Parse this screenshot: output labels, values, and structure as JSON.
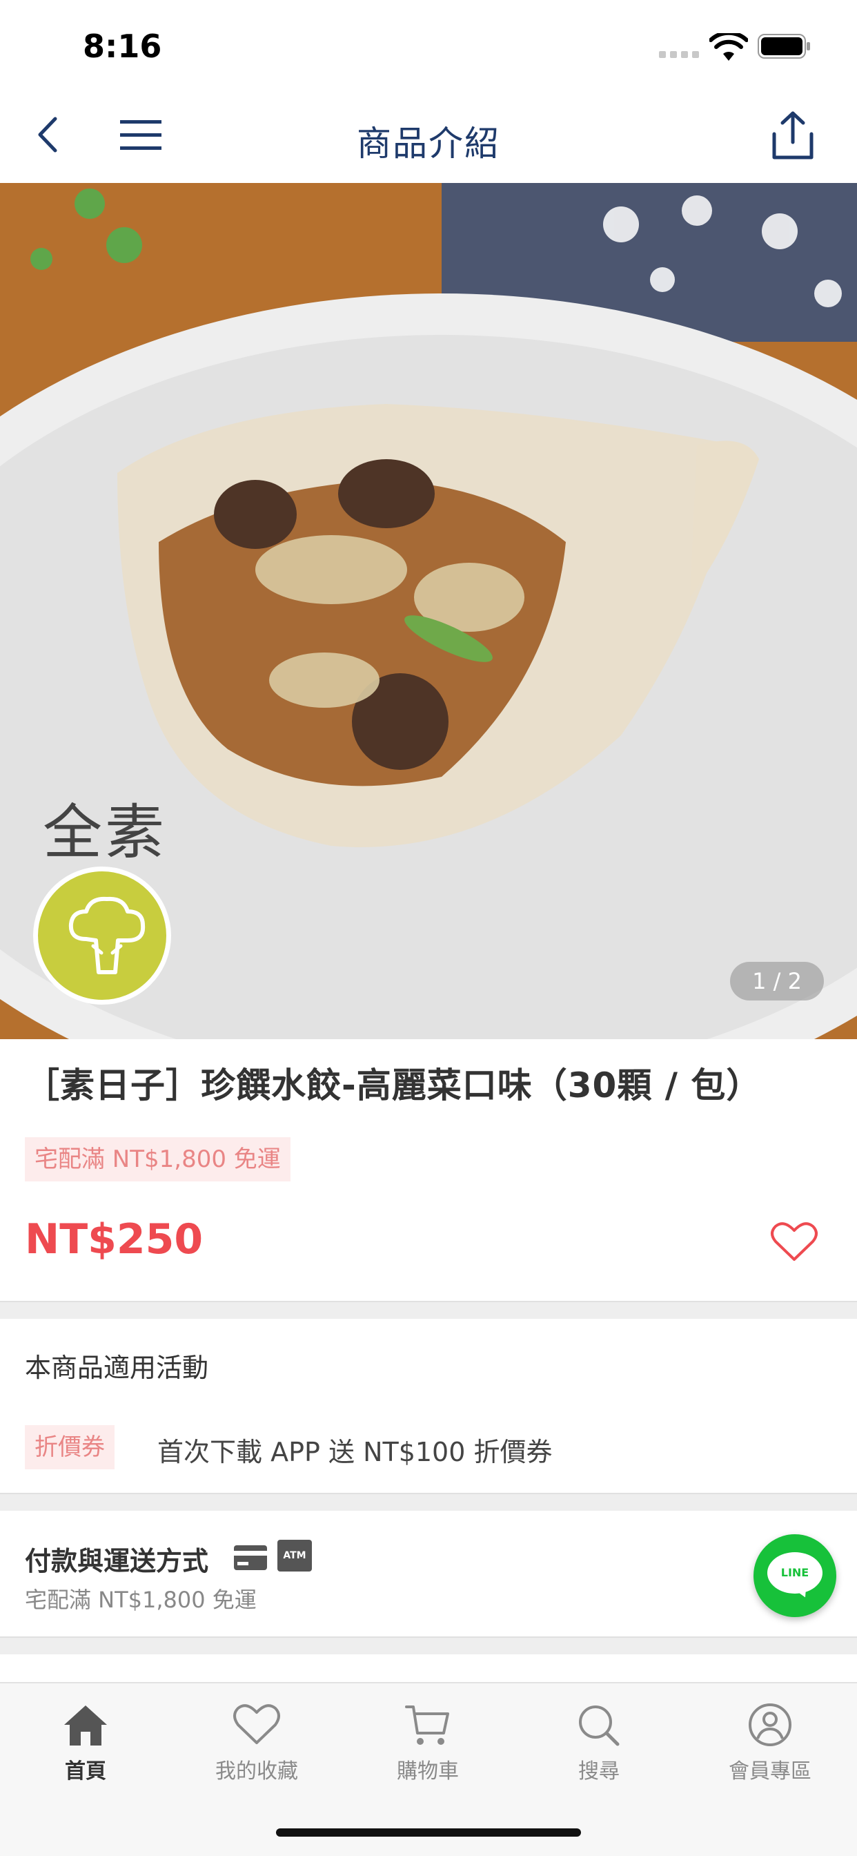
{
  "status_bar": {
    "time": "8:16"
  },
  "nav": {
    "title": "商品介紹",
    "back_icon": "chevron-left-icon",
    "menu_icon": "hamburger-menu-icon",
    "share_icon": "share-icon"
  },
  "hero": {
    "diet_label": "全素",
    "badge_icon": "broccoli-icon",
    "pager": "1 / 2"
  },
  "product": {
    "name": "［素日子］珍饌水餃-高麗菜口味（30顆 / 包）",
    "shipping_tag": "宅配滿 NT$1,800 免運",
    "price": "NT$250",
    "price_color": "#ee4a50"
  },
  "promotions": {
    "title": "本商品適用活動",
    "tag": "折價券",
    "text": "首次下載 APP 送 NT$100 折價券"
  },
  "payment": {
    "title": "付款與運送方式",
    "atm_label": "ATM",
    "subtitle": "宅配滿 NT$1,800 免運"
  },
  "line_button": {
    "label": "LINE",
    "color": "#17c13a"
  },
  "tab_bar": {
    "items": [
      {
        "label": "首頁",
        "icon": "home-icon",
        "active": true
      },
      {
        "label": "我的收藏",
        "icon": "heart-icon",
        "active": false
      },
      {
        "label": "購物車",
        "icon": "cart-icon",
        "active": false
      },
      {
        "label": "搜尋",
        "icon": "search-icon",
        "active": false
      },
      {
        "label": "會員專區",
        "icon": "user-icon",
        "active": false
      }
    ]
  }
}
